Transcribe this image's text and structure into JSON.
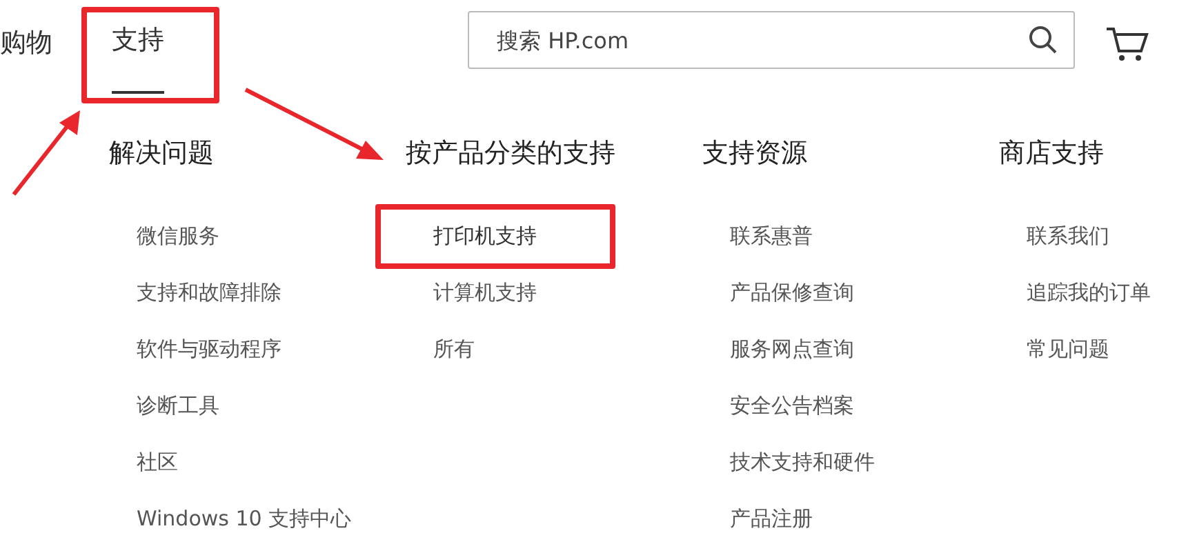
{
  "top_nav": [
    {
      "label": "购物",
      "selected": false,
      "highlighted": false
    },
    {
      "label": "支持",
      "selected": true,
      "highlighted": true
    }
  ],
  "search": {
    "placeholder": "搜索 HP.com"
  },
  "menu_columns": [
    {
      "heading": "解决问题",
      "items": [
        {
          "label": "微信服务",
          "highlighted": false
        },
        {
          "label": "支持和故障排除",
          "highlighted": false
        },
        {
          "label": "软件与驱动程序",
          "highlighted": false
        },
        {
          "label": "诊断工具",
          "highlighted": false
        },
        {
          "label": "社区",
          "highlighted": false
        },
        {
          "label": "Windows 10 支持中心",
          "highlighted": false
        }
      ]
    },
    {
      "heading": "按产品分类的支持",
      "items": [
        {
          "label": "打印机支持",
          "highlighted": true
        },
        {
          "label": "计算机支持",
          "highlighted": false
        },
        {
          "label": "所有",
          "highlighted": false
        }
      ]
    },
    {
      "heading": "支持资源",
      "items": [
        {
          "label": "联系惠普",
          "highlighted": false
        },
        {
          "label": "产品保修查询",
          "highlighted": false
        },
        {
          "label": "服务网点查询",
          "highlighted": false
        },
        {
          "label": "安全公告档案",
          "highlighted": false
        },
        {
          "label": "技术支持和硬件",
          "highlighted": false
        },
        {
          "label": "产品注册",
          "highlighted": false
        }
      ]
    },
    {
      "heading": "商店支持",
      "items": [
        {
          "label": "联系我们",
          "highlighted": false
        },
        {
          "label": "追踪我的订单",
          "highlighted": false
        },
        {
          "label": "常见问题",
          "highlighted": false
        }
      ]
    }
  ],
  "annotations": [
    {
      "kind": "arrow"
    },
    {
      "kind": "arrow"
    }
  ]
}
